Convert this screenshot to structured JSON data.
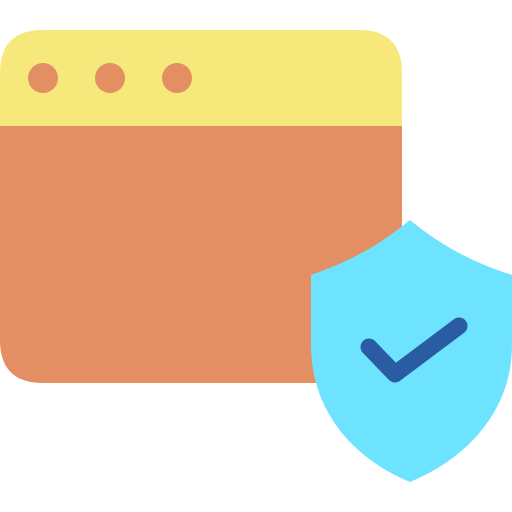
{
  "icon": {
    "name": "secure-browser-window-icon",
    "window": {
      "titlebar_color": "#F7E87C",
      "body_color": "#E38E63",
      "control_dots": [
        "window-control-dot-1",
        "window-control-dot-2",
        "window-control-dot-3"
      ],
      "control_dot_color": "#E38E63"
    },
    "shield": {
      "color": "#6EE3FF",
      "checkmark_color": "#2A5CA3"
    }
  }
}
